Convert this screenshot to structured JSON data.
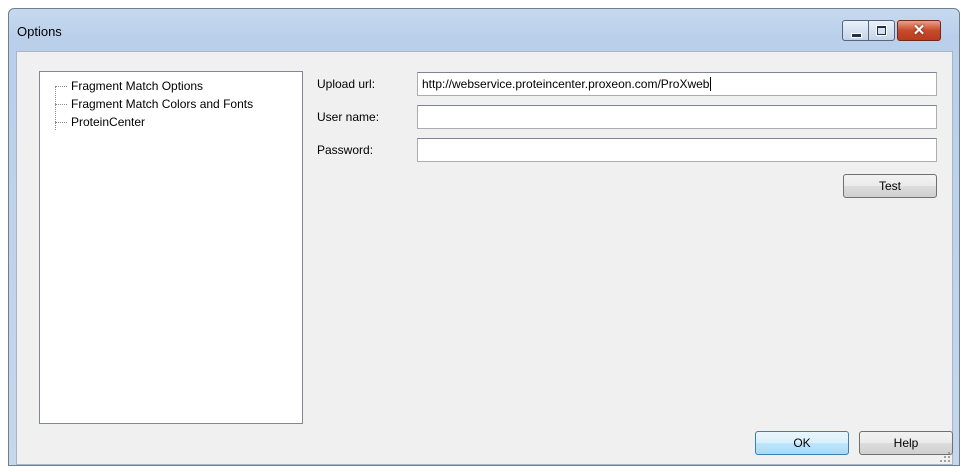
{
  "window": {
    "title": "Options",
    "close_glyph": "✕"
  },
  "tree": {
    "items": [
      {
        "label": "Fragment Match Options"
      },
      {
        "label": "Fragment Match Colors and Fonts"
      },
      {
        "label": "ProteinCenter"
      }
    ]
  },
  "form": {
    "upload_url": {
      "label": "Upload url:",
      "value": "http://webservice.proteincenter.proxeon.com/ProXweb"
    },
    "user_name": {
      "label": "User name:",
      "value": ""
    },
    "password": {
      "label": "Password:",
      "value": ""
    },
    "test_button": "Test"
  },
  "footer": {
    "ok_button": "OK",
    "help_button": "Help"
  },
  "icons": [
    "minimize-icon",
    "maximize-icon",
    "close-icon",
    "size-grip-icon"
  ]
}
